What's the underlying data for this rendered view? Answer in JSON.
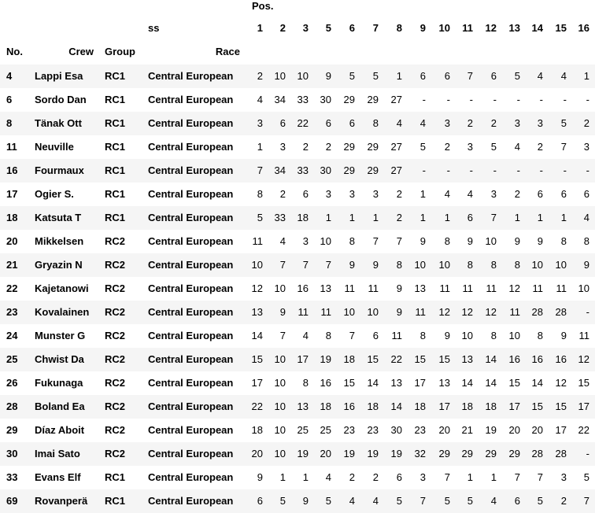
{
  "header": {
    "pos_label": "Pos.",
    "ss_label": "ss",
    "no_label": "No.",
    "crew_label": "Crew",
    "group_label": "Group",
    "race_label": "Race",
    "stages": [
      "1",
      "2",
      "3",
      "5",
      "6",
      "7",
      "8",
      "9",
      "10",
      "11",
      "12",
      "13",
      "14",
      "15",
      "16"
    ]
  },
  "rows": [
    {
      "no": "4",
      "crew": "Lappi Esa",
      "group": "RC1",
      "race": "Central European",
      "pos": [
        "2",
        "10",
        "10",
        "9",
        "5",
        "5",
        "1",
        "6",
        "6",
        "7",
        "6",
        "5",
        "4",
        "4",
        "1"
      ]
    },
    {
      "no": "6",
      "crew": "Sordo Dan",
      "group": "RC1",
      "race": "Central European",
      "pos": [
        "4",
        "34",
        "33",
        "30",
        "29",
        "29",
        "27",
        "-",
        "-",
        "-",
        "-",
        "-",
        "-",
        "-",
        "-"
      ]
    },
    {
      "no": "8",
      "crew": "Tänak Ott",
      "group": "RC1",
      "race": "Central European",
      "pos": [
        "3",
        "6",
        "22",
        "6",
        "6",
        "8",
        "4",
        "4",
        "3",
        "2",
        "2",
        "3",
        "3",
        "5",
        "2"
      ]
    },
    {
      "no": "11",
      "crew": "Neuville",
      "group": "RC1",
      "race": "Central European",
      "pos": [
        "1",
        "3",
        "2",
        "2",
        "29",
        "29",
        "27",
        "5",
        "2",
        "3",
        "5",
        "4",
        "2",
        "7",
        "3"
      ]
    },
    {
      "no": "16",
      "crew": "Fourmaux",
      "group": "RC1",
      "race": "Central European",
      "pos": [
        "7",
        "34",
        "33",
        "30",
        "29",
        "29",
        "27",
        "-",
        "-",
        "-",
        "-",
        "-",
        "-",
        "-",
        "-"
      ]
    },
    {
      "no": "17",
      "crew": "Ogier S.",
      "group": "RC1",
      "race": "Central European",
      "pos": [
        "8",
        "2",
        "6",
        "3",
        "3",
        "3",
        "2",
        "1",
        "4",
        "4",
        "3",
        "2",
        "6",
        "6",
        "6"
      ]
    },
    {
      "no": "18",
      "crew": "Katsuta T",
      "group": "RC1",
      "race": "Central European",
      "pos": [
        "5",
        "33",
        "18",
        "1",
        "1",
        "1",
        "2",
        "1",
        "1",
        "6",
        "7",
        "1",
        "1",
        "1",
        "4"
      ]
    },
    {
      "no": "20",
      "crew": "Mikkelsen",
      "group": "RC2",
      "race": "Central European",
      "pos": [
        "11",
        "4",
        "3",
        "10",
        "8",
        "7",
        "7",
        "9",
        "8",
        "9",
        "10",
        "9",
        "9",
        "8",
        "8"
      ]
    },
    {
      "no": "21",
      "crew": "Gryazin N",
      "group": "RC2",
      "race": "Central European",
      "pos": [
        "10",
        "7",
        "7",
        "7",
        "9",
        "9",
        "8",
        "10",
        "10",
        "8",
        "8",
        "8",
        "10",
        "10",
        "9"
      ]
    },
    {
      "no": "22",
      "crew": "Kajetanowi",
      "group": "RC2",
      "race": "Central European",
      "pos": [
        "12",
        "10",
        "16",
        "13",
        "11",
        "11",
        "9",
        "13",
        "11",
        "11",
        "11",
        "12",
        "11",
        "11",
        "10"
      ]
    },
    {
      "no": "23",
      "crew": "Kovalainen",
      "group": "RC2",
      "race": "Central European",
      "pos": [
        "13",
        "9",
        "11",
        "11",
        "10",
        "10",
        "9",
        "11",
        "12",
        "12",
        "12",
        "11",
        "28",
        "28",
        "-"
      ]
    },
    {
      "no": "24",
      "crew": "Munster G",
      "group": "RC2",
      "race": "Central European",
      "pos": [
        "14",
        "7",
        "4",
        "8",
        "7",
        "6",
        "11",
        "8",
        "9",
        "10",
        "8",
        "10",
        "8",
        "9",
        "11"
      ]
    },
    {
      "no": "25",
      "crew": "Chwist Da",
      "group": "RC2",
      "race": "Central European",
      "pos": [
        "15",
        "10",
        "17",
        "19",
        "18",
        "15",
        "22",
        "15",
        "15",
        "13",
        "14",
        "16",
        "16",
        "16",
        "12"
      ]
    },
    {
      "no": "26",
      "crew": "Fukunaga",
      "group": "RC2",
      "race": "Central European",
      "pos": [
        "17",
        "10",
        "8",
        "16",
        "15",
        "14",
        "13",
        "17",
        "13",
        "14",
        "14",
        "15",
        "14",
        "12",
        "15"
      ]
    },
    {
      "no": "28",
      "crew": "Boland Ea",
      "group": "RC2",
      "race": "Central European",
      "pos": [
        "22",
        "10",
        "13",
        "18",
        "16",
        "18",
        "14",
        "18",
        "17",
        "18",
        "18",
        "17",
        "15",
        "15",
        "17"
      ]
    },
    {
      "no": "29",
      "crew": "Díaz Aboit",
      "group": "RC2",
      "race": "Central European",
      "pos": [
        "18",
        "10",
        "25",
        "25",
        "23",
        "23",
        "30",
        "23",
        "20",
        "21",
        "19",
        "20",
        "20",
        "17",
        "22"
      ]
    },
    {
      "no": "30",
      "crew": "Imai Sato",
      "group": "RC2",
      "race": "Central European",
      "pos": [
        "20",
        "10",
        "19",
        "20",
        "19",
        "19",
        "19",
        "32",
        "29",
        "29",
        "29",
        "29",
        "28",
        "28",
        "-"
      ]
    },
    {
      "no": "33",
      "crew": "Evans Elf",
      "group": "RC1",
      "race": "Central European",
      "pos": [
        "9",
        "1",
        "1",
        "4",
        "2",
        "2",
        "6",
        "3",
        "7",
        "1",
        "1",
        "7",
        "7",
        "3",
        "5"
      ]
    },
    {
      "no": "69",
      "crew": "Rovanperä",
      "group": "RC1",
      "race": "Central European",
      "pos": [
        "6",
        "5",
        "9",
        "5",
        "4",
        "4",
        "5",
        "7",
        "5",
        "5",
        "4",
        "6",
        "5",
        "2",
        "7"
      ]
    }
  ]
}
